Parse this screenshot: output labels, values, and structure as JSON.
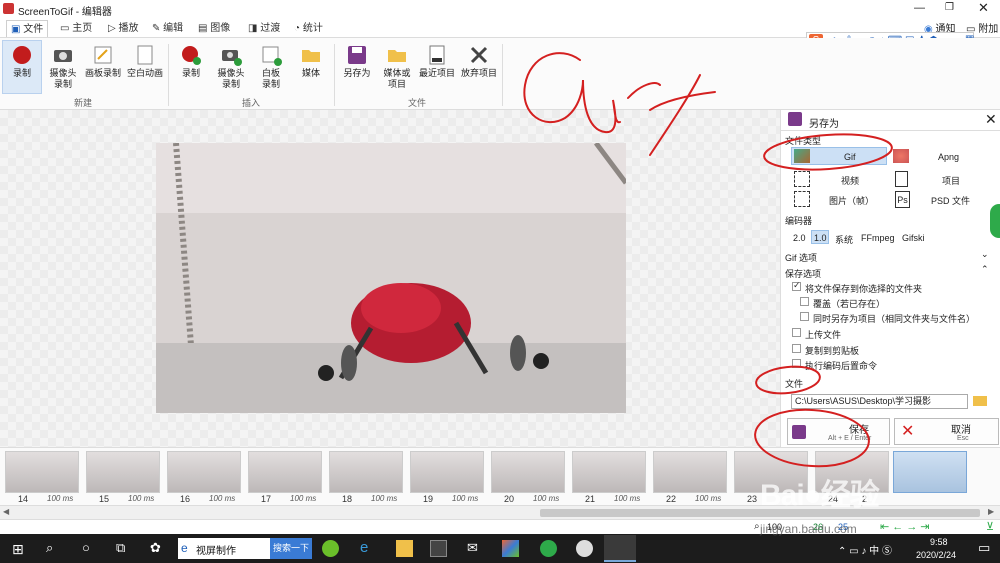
{
  "window": {
    "title": "ScreenToGif - 编辑器"
  },
  "tabs": [
    {
      "label": "文件",
      "icon": "save-icon"
    },
    {
      "label": "主页",
      "icon": "home-icon"
    },
    {
      "label": "播放",
      "icon": "play-icon"
    },
    {
      "label": "编辑",
      "icon": "pencil-icon"
    },
    {
      "label": "图像",
      "icon": "image-icon"
    },
    {
      "label": "过渡",
      "icon": "transition-icon"
    },
    {
      "label": "统计",
      "icon": "chart-icon"
    }
  ],
  "top_right": {
    "notify": "通知",
    "attach": "附加"
  },
  "ime": {
    "label": "中",
    "symbols": "°,",
    "extra": "简"
  },
  "ribbon": {
    "new_group": {
      "label": "新建",
      "record": "录制",
      "webcam": "摄像头\n录制",
      "board": "画板录制",
      "blank": "空白动画"
    },
    "insert_group": {
      "label": "插入",
      "record": "录制",
      "webcam": "摄像头\n录制",
      "board": "白板\n录制",
      "media": "媒体"
    },
    "file_group": {
      "label": "文件",
      "save_as": "另存为",
      "media_project": "媒体或\n项目",
      "recent": "最近项目",
      "discard": "放弃项目"
    }
  },
  "panel": {
    "title": "另存为",
    "file_type_label": "文件类型",
    "types": [
      {
        "label": "Gif",
        "icon": "gif-icon"
      },
      {
        "label": "Apng",
        "icon": "apng-icon"
      },
      {
        "label": "视频",
        "icon": "video-icon"
      },
      {
        "label": "项目",
        "icon": "project-icon"
      },
      {
        "label": "图片（帧）",
        "icon": "picture-icon"
      },
      {
        "label": "PSD 文件",
        "icon": "psd-icon"
      }
    ],
    "psd_badge": "Ps",
    "encoder_label": "编码器",
    "encoders": [
      "2.0",
      "1.0",
      "系统",
      "FFmpeg",
      "Gifski"
    ],
    "gif_options": "Gif 选项",
    "save_options": "保存选项",
    "opt_save_folder": "将文件保存到你选择的文件夹",
    "opt_overwrite": "覆盖（若已存在）",
    "opt_save_project": "同时另存为项目（相同文件夹与文件名）",
    "opt_upload": "上传文件",
    "opt_copy": "复制到剪贴板",
    "opt_post_cmd": "执行编码后置命令",
    "file_label": "文件",
    "path": "C:\\Users\\ASUS\\Desktop\\学习摄影",
    "save_btn": "保存",
    "save_hint": "Alt + E / Enter",
    "cancel_btn": "取消",
    "cancel_hint": "Esc"
  },
  "frames": [
    {
      "num": "14",
      "ms": "100 ms"
    },
    {
      "num": "15",
      "ms": "100 ms"
    },
    {
      "num": "16",
      "ms": "100 ms"
    },
    {
      "num": "17",
      "ms": "100 ms"
    },
    {
      "num": "18",
      "ms": "100 ms"
    },
    {
      "num": "19",
      "ms": "100 ms"
    },
    {
      "num": "20",
      "ms": "100 ms"
    },
    {
      "num": "21",
      "ms": "100 ms"
    },
    {
      "num": "22",
      "ms": "100 ms"
    },
    {
      "num": "23",
      "ms": ""
    },
    {
      "num": "24",
      "ms": ""
    },
    {
      "num": "2",
      "ms": ""
    }
  ],
  "status": {
    "zoom": "100",
    "count1": "26",
    "count2": "25"
  },
  "taskbar": {
    "search_text": "视屏制作",
    "search_btn": "搜索一下",
    "time": "9:58",
    "date": "2020/2/24",
    "ime": "中"
  },
  "watermark": {
    "site": "jingyan.baidu.com"
  },
  "colors": {
    "accent": "#1f5fb8",
    "ink": "#d42020",
    "selection": "#cce0f5"
  }
}
